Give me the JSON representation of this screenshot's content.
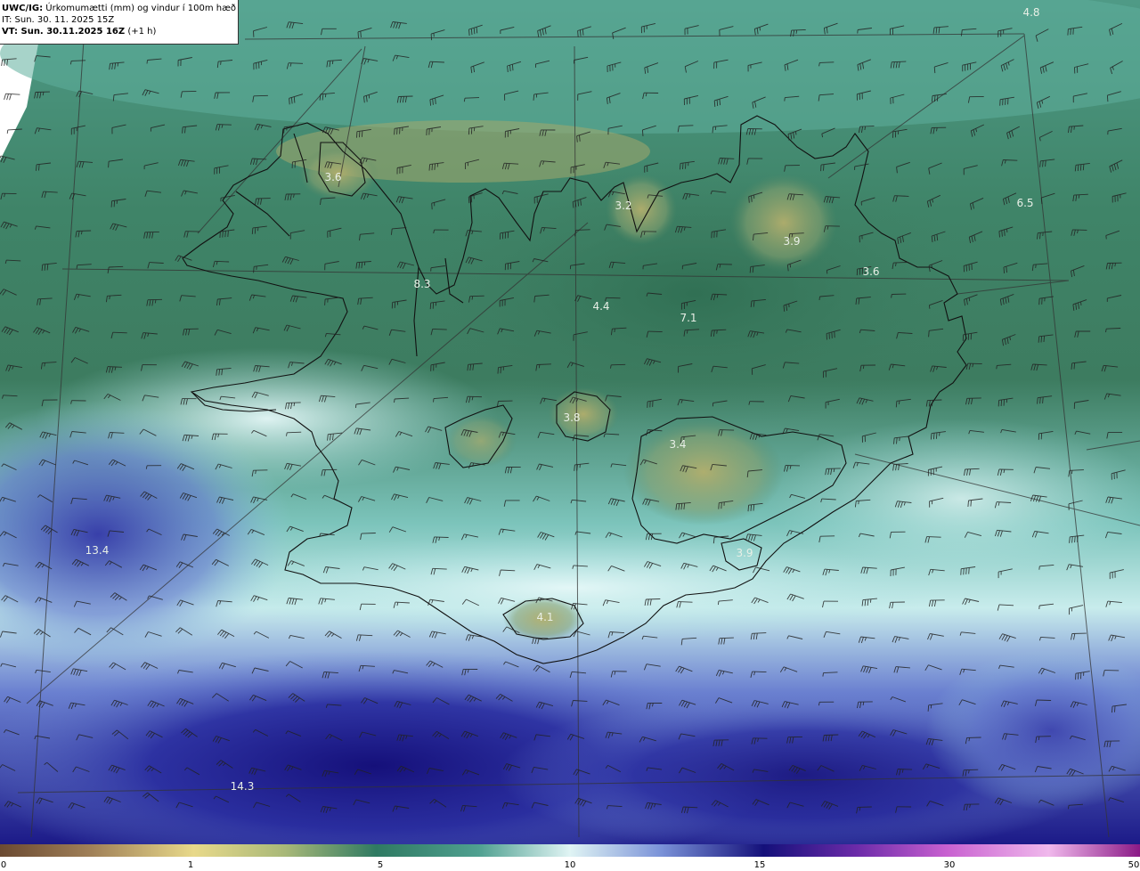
{
  "header": {
    "model": "UWC/IG:",
    "product": "Úrkomumætti (mm) og vindur í 100m hæð",
    "it_line": "IT: Sun. 30. 11. 2025 15Z",
    "vt_prefix": "VT: Sun. 30.11.2025 16Z",
    "vt_suffix": "(+1 h)"
  },
  "map_labels": [
    {
      "text": "4.8",
      "lon_lat_name": "ne-corner"
    },
    {
      "text": "3.6",
      "lon_lat_name": "westfjords-north"
    },
    {
      "text": "3.2",
      "lon_lat_name": "trollaskagi"
    },
    {
      "text": "6.5",
      "lon_lat_name": "east-sea"
    },
    {
      "text": "3.9",
      "lon_lat_name": "northeast-highland"
    },
    {
      "text": "3.6",
      "lon_lat_name": "east-fjords"
    },
    {
      "text": "8.3",
      "lon_lat_name": "breidafjordur"
    },
    {
      "text": "4.4",
      "lon_lat_name": "north-central"
    },
    {
      "text": "7.1",
      "lon_lat_name": "central-highland"
    },
    {
      "text": "3.8",
      "lon_lat_name": "hofsjokull"
    },
    {
      "text": "3.4",
      "lon_lat_name": "vatnajokull"
    },
    {
      "text": "3.9",
      "lon_lat_name": "oraefajokull"
    },
    {
      "text": "13.4",
      "lon_lat_name": "west-sea"
    },
    {
      "text": "4.1",
      "lon_lat_name": "myrdalsjokull"
    },
    {
      "text": "14.3",
      "lon_lat_name": "southwest-sea"
    }
  ],
  "legend": {
    "ticks": [
      "0",
      "1",
      "5",
      "10",
      "15",
      "30",
      "50"
    ],
    "colors": [
      "#6b4a32",
      "#b89a6a",
      "#e8d98a",
      "#8fb07a",
      "#3f8a6a",
      "#2f7a66",
      "#6fc2b6",
      "#d8f2f2",
      "#6a82d0",
      "#1d1a8c",
      "#5a1a9a",
      "#c84ac8",
      "#f0b0e8",
      "#9a1a8a"
    ]
  },
  "colors": {
    "land_green": "#3e7d62",
    "sea_teal": "#5aa898",
    "heavy_blue": "#2a2ea0",
    "glacier_yellow": "#a8a868",
    "barb_color": "#222222",
    "coast_color": "#111111"
  }
}
